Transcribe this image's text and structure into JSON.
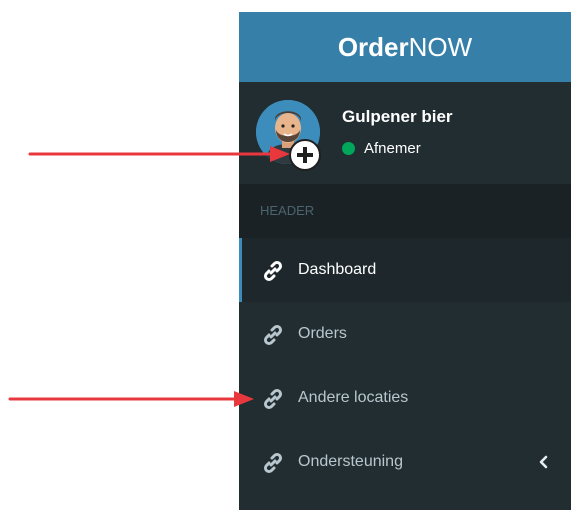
{
  "logo": {
    "bold": "Order",
    "light": "NOW"
  },
  "user": {
    "name": "Gulpener bier",
    "status": "Afnemer"
  },
  "menu": {
    "header": "HEADER",
    "items": [
      {
        "label": "Dashboard",
        "active": true
      },
      {
        "label": "Orders"
      },
      {
        "label": "Andere locaties"
      },
      {
        "label": "Ondersteuning",
        "has_submenu": true
      }
    ]
  },
  "colors": {
    "logo_bg": "#367fa9",
    "sidebar_bg": "#222d32",
    "active_bg": "#1e282c",
    "accent": "#3c8dbc",
    "status_online": "#00a65a",
    "annotation_arrow": "#e8383d"
  },
  "icons": [
    "link-icon",
    "add-icon",
    "chevron-left-icon",
    "avatar-illustration"
  ]
}
